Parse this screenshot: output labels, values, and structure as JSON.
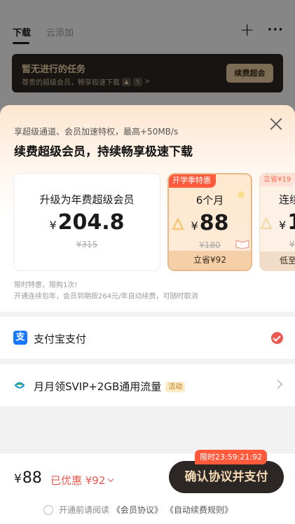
{
  "background_app": {
    "tabs": [
      "下载",
      "云添加"
    ],
    "active_tab_index": 0,
    "task_card": {
      "title": "暂无进行的任务",
      "subtitle": "尊贵的超级会员，畅享极速下载",
      "arrow": ">",
      "renew_button": "续费超会"
    }
  },
  "sheet": {
    "subtitle": "享超级通道、会员加速特权，最高+50MB/s",
    "headline": "续费超级会员，持续畅享极速下载",
    "plans": [
      {
        "name": "升级为年费超级会员",
        "currency": "¥",
        "price": "204.8",
        "original": "¥315",
        "save": "",
        "tag": ""
      },
      {
        "name": "6个月",
        "currency": "¥",
        "price": "88",
        "original": "¥180",
        "save": "立省¥92",
        "tag": "开学季特惠"
      },
      {
        "name": "连续",
        "currency": "¥",
        "price": "1",
        "original": "¥",
        "save": "低至",
        "tag": "立省¥19"
      }
    ],
    "selected_plan_index": 1,
    "notes": [
      "限时特惠，限购1次!",
      "开通连续包年，会员到期按264元/年自动续费，可随时取消"
    ],
    "payment": {
      "label": "支付宝支付",
      "icon": "alipay-icon",
      "checked": true
    },
    "promo_row": {
      "label": "月月领SVIP+2GB通用流量",
      "tag": "活动"
    },
    "bottom": {
      "currency": "¥",
      "price": "88",
      "discount": "已优惠 ¥92",
      "timer": "限时23:59:21:92",
      "confirm_button": "确认协议并支付",
      "agree_prefix": "开通前请阅读",
      "agree_link_1": "《会员协议》",
      "agree_link_2": "《自动续费规则》"
    }
  },
  "colors": {
    "accent_red": "#e95a50",
    "promo_orange": "#ff5a3c",
    "dark_button": "#2c2724",
    "gold_text": "#f5d9b5",
    "selected_border": "#e7b98a"
  }
}
